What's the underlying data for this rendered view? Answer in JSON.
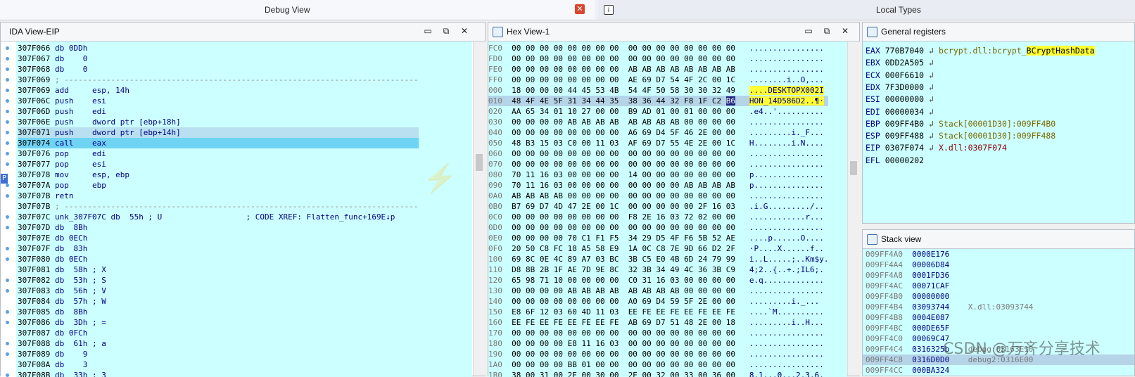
{
  "tabs": {
    "debug_view": "Debug View",
    "local_types": "Local Types"
  },
  "ida": {
    "title": "IDA View-EIP",
    "lines": [
      {
        "addr": "307F066",
        "text": " db 0DDh"
      },
      {
        "addr": "307F067",
        "text": " db    0"
      },
      {
        "addr": "307F068",
        "text": " db    0"
      },
      {
        "addr": "307F069",
        "text": " ; ----------------------------------------------------------------------------"
      },
      {
        "addr": "307F069",
        "text": " add     esp, 14h"
      },
      {
        "addr": "307F06C",
        "text": " push    esi"
      },
      {
        "addr": "307F06D",
        "text": " push    edi"
      },
      {
        "addr": "307F06E",
        "text": " push    dword ptr [ebp+18h]"
      },
      {
        "addr": "307F071",
        "text": " push    dword ptr [ebp+14h]"
      },
      {
        "addr": "307F074",
        "text": " call    eax"
      },
      {
        "addr": "307F076",
        "text": " pop     edi"
      },
      {
        "addr": "307F077",
        "text": " pop     esi"
      },
      {
        "addr": "307F078",
        "text": " mov     esp, ebp"
      },
      {
        "addr": "307F07A",
        "text": " pop     ebp"
      },
      {
        "addr": "307F07B",
        "text": " retn"
      },
      {
        "addr": "307F07B",
        "text": " ; ----------------------------------------------------------------------------"
      },
      {
        "addr": "307F07C",
        "text": " unk_307F07C db  55h ; U                  ; CODE XREF: Flatten_func+169E↓p"
      },
      {
        "addr": "307F07D",
        "text": " db  8Bh"
      },
      {
        "addr": "307F07E",
        "text": " db 0ECh"
      },
      {
        "addr": "307F07F",
        "text": " db  83h"
      },
      {
        "addr": "307F080",
        "text": " db 0ECh"
      },
      {
        "addr": "307F081",
        "text": " db  58h ; X"
      },
      {
        "addr": "307F082",
        "text": " db  53h ; S"
      },
      {
        "addr": "307F083",
        "text": " db  56h ; V"
      },
      {
        "addr": "307F084",
        "text": " db  57h ; W"
      },
      {
        "addr": "307F085",
        "text": " db  8Bh"
      },
      {
        "addr": "307F086",
        "text": " db  3Dh ; ="
      },
      {
        "addr": "307F087",
        "text": " db 0FCh"
      },
      {
        "addr": "307F088",
        "text": " db  61h ; a"
      },
      {
        "addr": "307F089",
        "text": " db    9"
      },
      {
        "addr": "307F08A",
        "text": " db    3"
      },
      {
        "addr": "307F08B",
        "text": " db  33h ; 3"
      }
    ],
    "marker": "P"
  },
  "hex": {
    "title": "Hex View-1",
    "rows": [
      {
        "a": "FC0",
        "b": "00 00 00 00 00 00 00 00  00 00 00 00 00 00 00 00",
        "s": "................"
      },
      {
        "a": "FD0",
        "b": "00 00 00 00 00 00 00 00  00 00 00 00 00 00 00 00",
        "s": "................"
      },
      {
        "a": "FE0",
        "b": "00 00 00 00 00 00 00 00  AB AB AB AB AB AB AB AB",
        "s": "................"
      },
      {
        "a": "FF0",
        "b": "00 00 00 00 00 00 00 00  AE 69 D7 54 4F 2C 00 1C",
        "s": "........i..O,..."
      },
      {
        "a": "000",
        "b": "18 00 00 00 44 45 53 4B  54 4F 50 58 30 30 32 49",
        "s": "....DESKTOPX002I"
      },
      {
        "a": "010",
        "b": "48 4F 4E 5F 31 34 44 35  38 36 44 32 F8 1F C2 B6",
        "s": "HON_14D586D2..¶·"
      },
      {
        "a": "020",
        "b": "AA 65 34 01 10 27 00 00  B9 AD 01 00 01 00 00 00",
        "s": ".e4..'.........."
      },
      {
        "a": "030",
        "b": "00 00 00 00 AB AB AB AB  AB AB AB AB 00 00 00 00",
        "s": "................"
      },
      {
        "a": "040",
        "b": "00 00 00 00 00 00 00 00  A6 69 D4 5F 46 2E 00 00",
        "s": ".........i._F..."
      },
      {
        "a": "050",
        "b": "48 B3 15 03 C0 00 11 03  AF 69 D7 55 4E 2E 00 1C",
        "s": "H........i.N...."
      },
      {
        "a": "060",
        "b": "00 00 00 00 00 00 00 00  00 00 00 00 00 00 00 00",
        "s": "................"
      },
      {
        "a": "070",
        "b": "00 00 00 00 00 00 00 00  00 00 00 00 00 00 00 00",
        "s": "................"
      },
      {
        "a": "080",
        "b": "70 11 16 03 00 00 00 00  14 00 00 00 00 00 00 00",
        "s": "p..............."
      },
      {
        "a": "090",
        "b": "70 11 16 03 00 00 00 00  00 00 00 00 AB AB AB AB",
        "s": "p..............."
      },
      {
        "a": "0A0",
        "b": "AB AB AB AB 00 00 00 00  00 00 00 00 00 00 00 00",
        "s": "................"
      },
      {
        "a": "0B0",
        "b": "B7 69 D7 4D 47 2E 00 1C  00 00 00 00 00 2F 16 03",
        "s": ".i.G........./.."
      },
      {
        "a": "0C0",
        "b": "00 00 00 00 00 00 00 00  F8 2E 16 03 72 02 00 00",
        "s": "............r..."
      },
      {
        "a": "0D0",
        "b": "00 00 00 00 00 00 00 00  00 00 00 00 00 00 00 00",
        "s": "................"
      },
      {
        "a": "0E0",
        "b": "00 00 00 00 70 C1 F1 F5  34 29 D5 4F F6 5B 52 AE",
        "s": "....p......O...."
      },
      {
        "a": "0F0",
        "b": "20 50 C8 FC 18 A5 58 E9  1A 0C C8 7E 9D 66 D2 2F",
        "s": "·P....X......f.."
      },
      {
        "a": "100",
        "b": "69 8C 0E 4C 89 A7 03 BC  3B C5 E0 4B 6D 24 79 99",
        "s": "i..L.....;..Km$y."
      },
      {
        "a": "110",
        "b": "D8 8B 2B 1F AE 7D 9E 8C  32 3B 34 49 4C 36 3B C9",
        "s": "4;2..{..+.;IL6;."
      },
      {
        "a": "120",
        "b": "65 98 71 10 00 00 00 00  C0 31 16 03 00 00 00 00",
        "s": "e.q............."
      },
      {
        "a": "130",
        "b": "00 00 00 00 AB AB AB AB  AB AB AB AB 00 00 00 00",
        "s": "................"
      },
      {
        "a": "140",
        "b": "00 00 00 00 00 00 00 00  A0 69 D4 59 5F 2E 00 00",
        "s": ".........i._..."
      },
      {
        "a": "150",
        "b": "E8 6F 12 03 60 4D 11 03  EE FE EE FE EE FE EE FE",
        "s": "....`M.........."
      },
      {
        "a": "160",
        "b": "EE FE EE FE EE FE EE FE  AB 69 D7 51 48 2E 00 18",
        "s": ".........i..H..."
      },
      {
        "a": "170",
        "b": "00 00 00 00 00 00 00 00  00 00 00 00 00 00 00 00",
        "s": "................"
      },
      {
        "a": "180",
        "b": "00 00 00 00 E8 11 16 03  00 00 00 00 00 00 00 00",
        "s": "................"
      },
      {
        "a": "190",
        "b": "00 00 00 00 00 00 00 00  00 00 00 00 00 00 00 00",
        "s": "................"
      },
      {
        "a": "1A0",
        "b": "00 00 00 00 BB 01 00 00  00 00 00 00 00 00 00 00",
        "s": "................"
      },
      {
        "a": "1B0",
        "b": "38 00 31 00 2E 00 30 00  2E 00 32 00 33 00 36 00",
        "s": "8.1...0...2.3.6."
      }
    ],
    "highlight_a": "DESKTOPX002I",
    "highlight_b": "HON_14D586D2.."
  },
  "registers": {
    "title": "General registers",
    "items": [
      {
        "name": "EAX",
        "value": "770B7040",
        "desc": "bcrypt.dll:bcrypt_",
        "desc_hl": "BCryptHashData",
        "arrow": true
      },
      {
        "name": "EBX",
        "value": "0DD2A505",
        "desc": "",
        "arrow": true
      },
      {
        "name": "ECX",
        "value": "000F6610",
        "desc": "",
        "arrow": true
      },
      {
        "name": "EDX",
        "value": "7F3D0000",
        "desc": "",
        "arrow": true
      },
      {
        "name": "ESI",
        "value": "00000000",
        "desc": "",
        "arrow": true
      },
      {
        "name": "EDI",
        "value": "00000034",
        "desc": "",
        "arrow": true
      },
      {
        "name": "EBP",
        "value": "009FF4B0",
        "desc": "Stack[00001D30]:009FF4B0",
        "arrow": true
      },
      {
        "name": "ESP",
        "value": "009FF488",
        "desc": "Stack[00001D30]:009FF488",
        "arrow": true
      },
      {
        "name": "EIP",
        "value": "0307F074",
        "desc": "X.dll:0307F074",
        "arrow": true
      },
      {
        "name": "EFL",
        "value": "00000202",
        "desc": "",
        "arrow": false
      }
    ]
  },
  "stack": {
    "title": "Stack view",
    "rows": [
      {
        "a": "009FF4A0",
        "v": "0000E176",
        "c": ""
      },
      {
        "a": "009FF4A4",
        "v": "00006D84",
        "c": ""
      },
      {
        "a": "009FF4A8",
        "v": "0001FD36",
        "c": ""
      },
      {
        "a": "009FF4AC",
        "v": "00071CAF",
        "c": ""
      },
      {
        "a": "009FF4B0",
        "v": "00000000",
        "c": ""
      },
      {
        "a": "009FF4B4",
        "v": "03093744",
        "c": "X.dll:03093744"
      },
      {
        "a": "009FF4B8",
        "v": "0004E087",
        "c": ""
      },
      {
        "a": "009FF4BC",
        "v": "000DE65F",
        "c": ""
      },
      {
        "a": "009FF4C0",
        "v": "00069C47",
        "c": ""
      },
      {
        "a": "009FF4C4",
        "v": "0316325b",
        "c": "debug:03163E10"
      },
      {
        "a": "009FF4C8",
        "v": "0316D0D0",
        "c": "debug2:0316E00"
      },
      {
        "a": "009FF4CC",
        "v": "000BA324",
        "c": ""
      }
    ]
  },
  "watermark": "CSDN @万齐分享技术"
}
